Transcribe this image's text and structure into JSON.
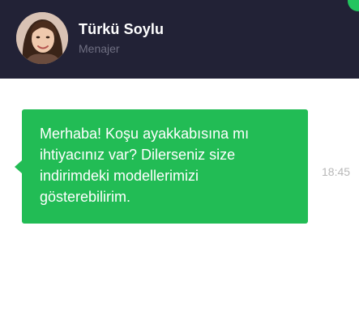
{
  "contact": {
    "name": "Türkü Soylu",
    "role": "Menajer",
    "avatar_icon": "user-avatar-photo"
  },
  "message": {
    "text": "Merhaba! Koşu ayakkabısına mı ihtiyacınız var? Dilerseniz size indirimdeki modellerimizi gösterebilirim.",
    "time": "18:45"
  },
  "colors": {
    "header_bg": "#222236",
    "bubble_bg": "#22bc55",
    "accent": "#22c55e",
    "role_text": "#6f6f82",
    "timestamp_text": "#b8b8b8"
  }
}
